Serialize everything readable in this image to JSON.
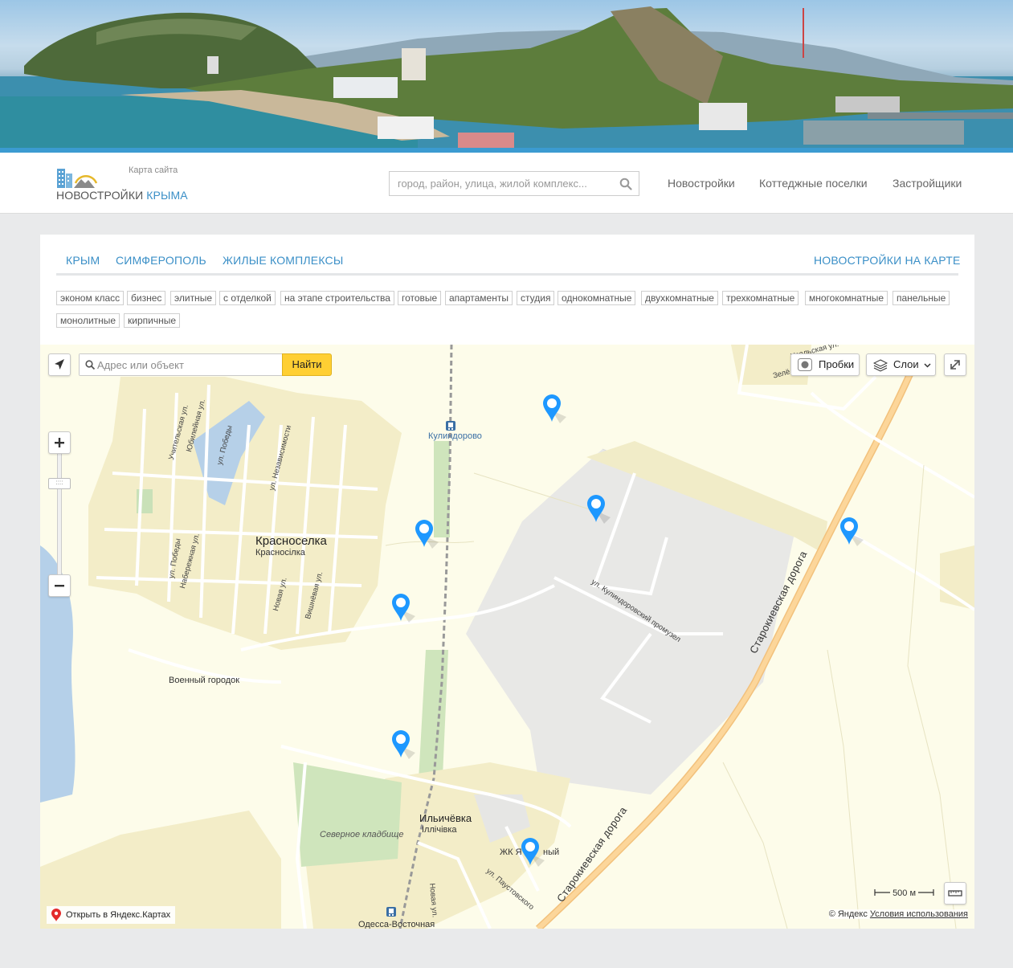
{
  "header": {
    "logo_text_main": "НОВОСТРОЙКИ",
    "logo_text_accent": "КРЫМА",
    "sitemap": "Карта сайта",
    "search_placeholder": "город, район, улица, жилой комплекс...",
    "nav": [
      "Новостройки",
      "Коттеджные поселки",
      "Застройщики"
    ]
  },
  "breadcrumbs": {
    "items": [
      "КРЫМ",
      "СИМФЕРОПОЛЬ",
      "ЖИЛЫЕ КОМПЛЕКСЫ"
    ],
    "right": "НОВОСТРОЙКИ НА КАРТЕ"
  },
  "tags": [
    "эконом класс",
    "бизнес",
    "элитные",
    "с отделкой",
    "на этапе строительства",
    "готовые",
    "апартаменты",
    "студия",
    "однокомнатные",
    "двухкомнатные",
    "трехкомнатные",
    "многокомнатные",
    "панельные",
    "монолитные",
    "кирпичные"
  ],
  "map": {
    "search_placeholder": "Адрес или объект",
    "find_label": "Найти",
    "traffic_label": "Пробки",
    "layers_label": "Слои",
    "scale_label": "500 м",
    "open_in_yandex": "Открыть в Яндекс.Картах",
    "copyright": "© Яндекс",
    "terms": "Условия использования",
    "labels": {
      "krasnoselka": "Красноселка",
      "krasnoselka_ua": "Красносілка",
      "military_town": "Военный городок",
      "kulindorovo": "Кулиндорово",
      "ilichevka": "Ильичёвка",
      "ilichevka_ua": "Іллічівка",
      "north_cemetery": "Северное кладбище",
      "odessa_east": "Одесса-Восточная",
      "jk_partial": "ЖК Я",
      "jk_partial_2": "ный",
      "street_kulindorovsky": "ул. Кулиндоровский промузел",
      "road_starokievskaya": "Старокиевская дорога",
      "street_paustovsky": "ул. Паустовского",
      "street_novaya": "Новая ул.",
      "street_novaya_2": "Новая ул.",
      "street_vishnevaya": "Вишнёвая ул.",
      "street_nezavisimosti": "ул. Независимости",
      "street_pobedy": "ул. Победы",
      "street_pobedy_2": "ул. Победы",
      "street_uchitelskaya": "Учительская ул.",
      "street_yubileynaya": "Юбилейная ул.",
      "street_naberezhnaya": "Набережная ул.",
      "street_uralskaya": "Уральская ул.",
      "street_zelenaya": "Зелё"
    }
  }
}
